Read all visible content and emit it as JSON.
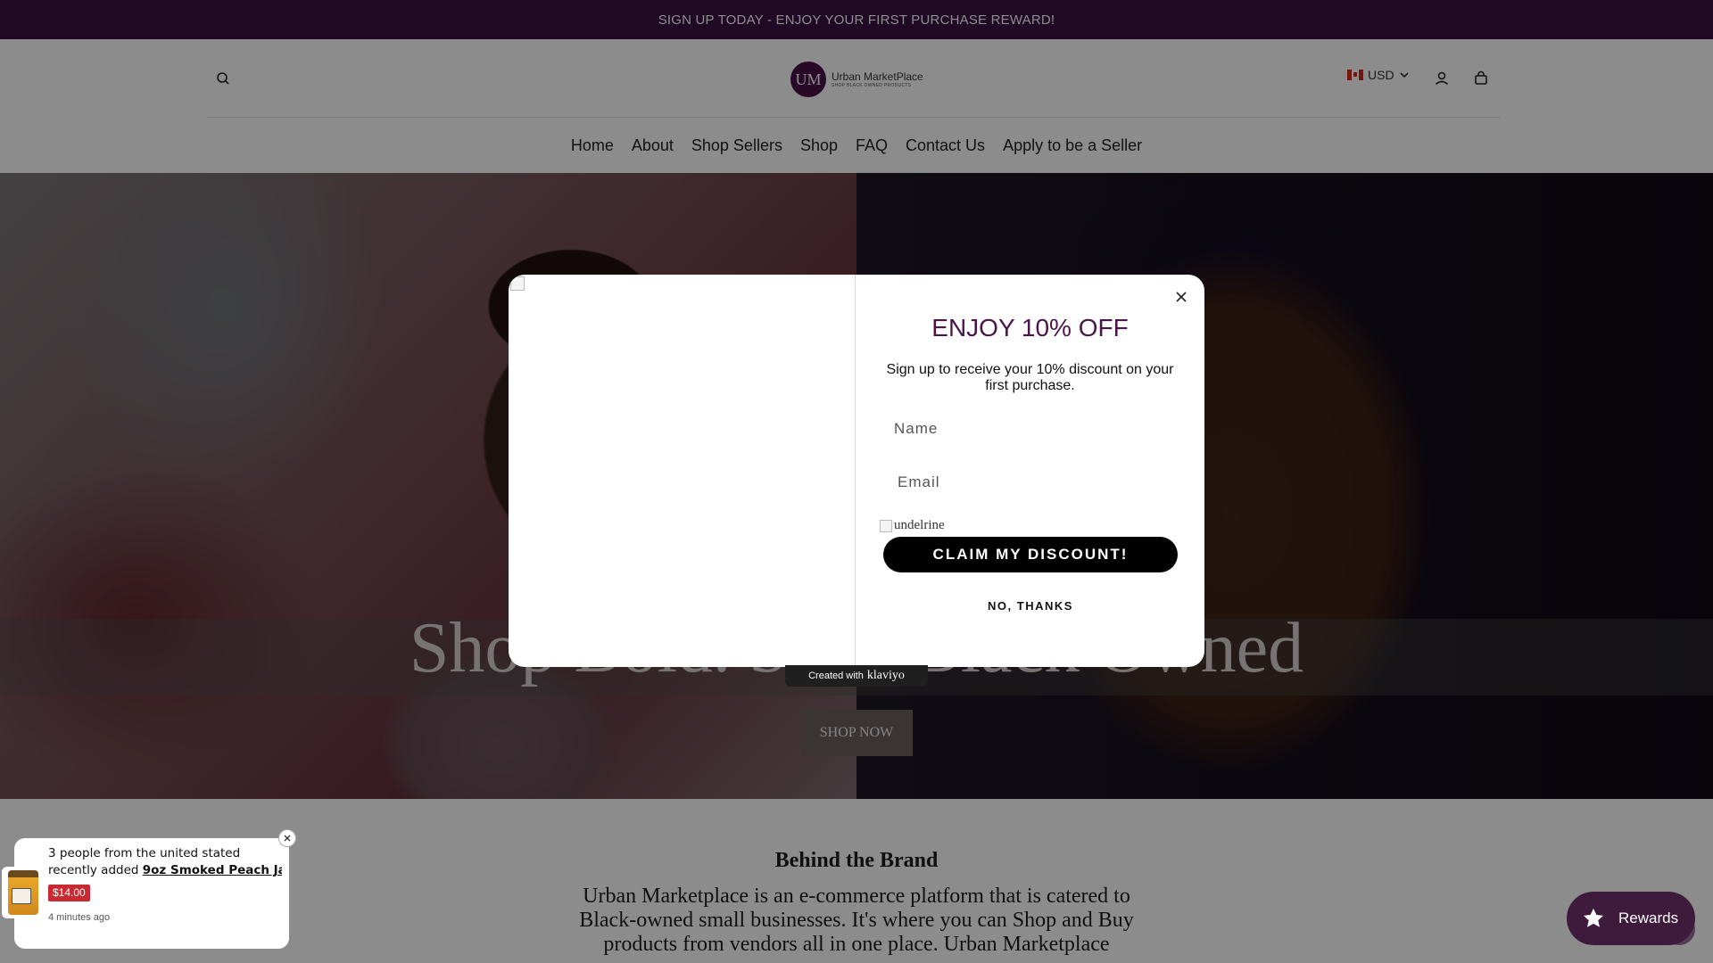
{
  "announcement": "SIGN UP TODAY - ENJOY YOUR FIRST PURCHASE REWARD!",
  "header": {
    "logo_initials": "UM",
    "logo_name": "Urban MarketPlace",
    "logo_tagline": "SHOP BLACK OWNED PRODUCTS",
    "currency": "USD",
    "icons": [
      "search-icon",
      "flag-icon",
      "chevron-down-icon",
      "account-icon",
      "cart-icon"
    ]
  },
  "nav": [
    "Home",
    "About",
    "Shop Sellers",
    "Shop",
    "FAQ",
    "Contact Us",
    "Apply to be a Seller"
  ],
  "hero": {
    "title": "Shop Bold. Shop Black Owned",
    "button": "SHOP NOW"
  },
  "brand": {
    "title": "Behind the Brand",
    "text": "Urban Marketplace is an e-commerce platform that is catered to Black-owned small businesses. It's where you can Shop and Buy products from vendors all in one place. Urban Marketplace"
  },
  "popup": {
    "heading": "ENJOY 10% OFF",
    "subtext": "Sign up to receive your 10% discount on your first purchase.",
    "name_placeholder": "Name",
    "email_placeholder": "Email",
    "broken_image_alt": "undelrine",
    "claim_button": "CLAIM MY DISCOUNT!",
    "decline": "NO, THANKS",
    "credit_prefix": "Created with",
    "credit_brand": "klaviyo"
  },
  "toast": {
    "line1": "3 people from the united stated",
    "line2_prefix": "recently added",
    "product": "9oz Smoked Peach Ja...",
    "price": "$14.00",
    "time": "4 minutes ago"
  },
  "rewards": {
    "label": "Rewards"
  },
  "colors": {
    "brand_purple": "#3b1243",
    "heading_purple": "#4a1549",
    "price_red": "#c92a31"
  }
}
